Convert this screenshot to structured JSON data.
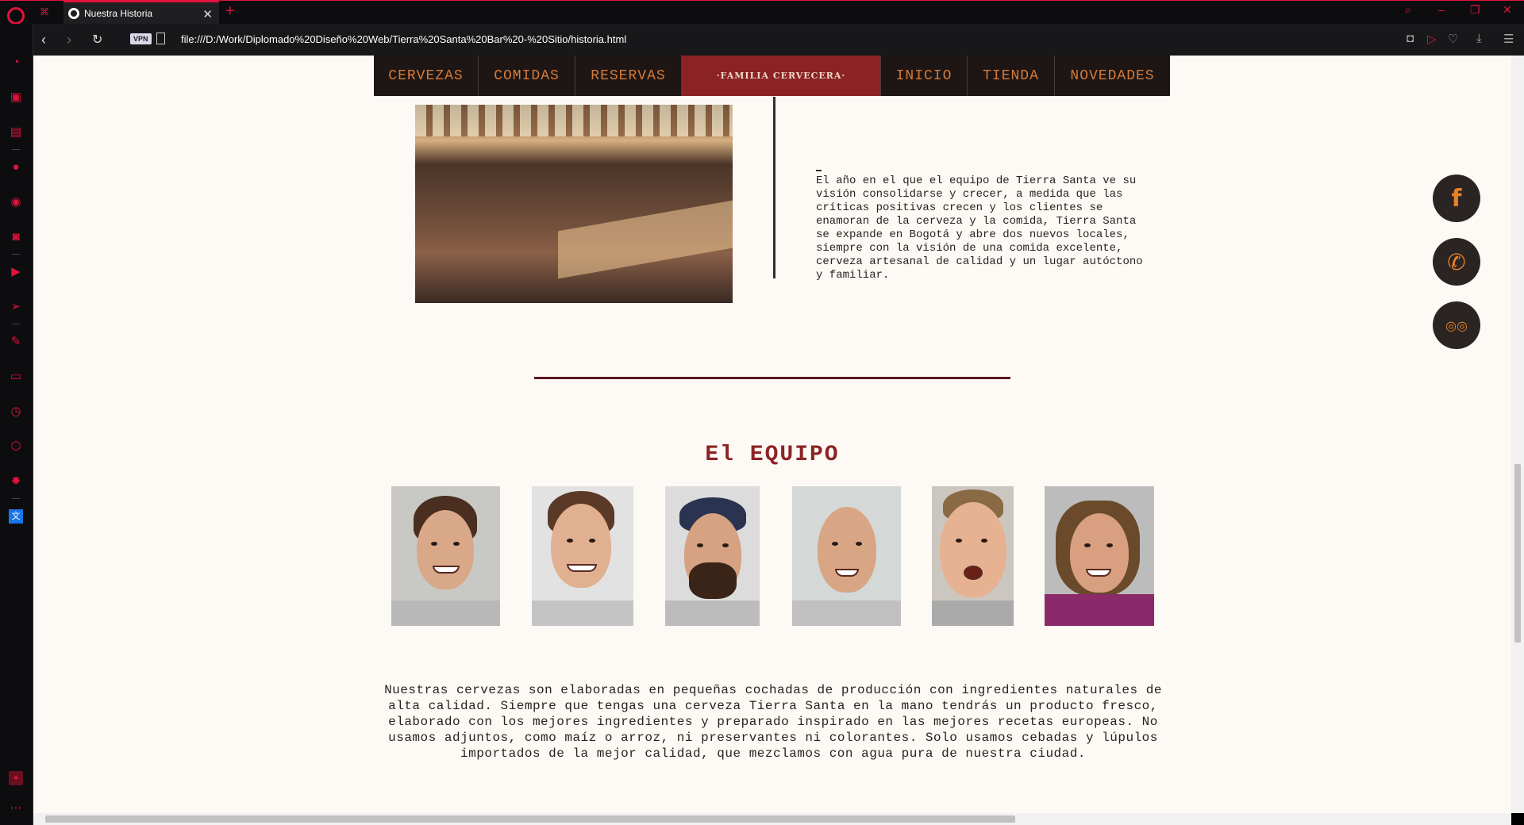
{
  "browser": {
    "tab_title": "Nuestra Historia",
    "tab_close": "✕",
    "new_tab": "+",
    "url": "file:///D:/Work/Diplomado%20Diseño%20Web/Tierra%20Santa%20Bar%20-%20Sitio/historia.html",
    "vpn_label": "VPN",
    "back": "‹",
    "forward": "›",
    "reload": "↻",
    "minimize": "–",
    "restore": "❐",
    "close": "✕",
    "search_glyph": "⌕"
  },
  "site_nav": {
    "items_left": [
      "CERVEZAS",
      "COMIDAS",
      "RESERVAS"
    ],
    "brand": "·FAMILIA CERVECERA·",
    "items_right": [
      "INICIO",
      "TIENDA",
      "NOVEDADES"
    ]
  },
  "story": {
    "dash": "_",
    "text": "El año en el que el equipo de Tierra Santa ve su visión consolidarse y crecer, a medida que las críticas positivas crecen y los clientes se enamoran de la cerveza y la comida, Tierra Santa se expande en Bogotá y abre dos nuevos locales, siempre con la visión de una comida excelente, cerveza artesanal de calidad y un lugar autóctono y familiar."
  },
  "team": {
    "title": "El EQUIPO",
    "paragraph": "Nuestras cervezas son elaboradas en pequeñas cochadas de producción con ingredientes naturales de alta calidad. Siempre que tengas una cerveza Tierra Santa en la mano tendrás un producto fresco, elaborado con los mejores ingredientes y preparado inspirado en las mejores recetas europeas. No usamos adjuntos, como maíz o arroz, ni preservantes ni colorantes. Solo usamos cebadas y lúpulos importados de la mejor calidad, que mezclamos con agua pura de nuestra ciudad."
  },
  "social": {
    "facebook": "f",
    "phone": "✆",
    "tripadvisor": "◎◎"
  },
  "colors": {
    "accent": "#e0133c",
    "nav_bg": "#1e1614",
    "nav_text": "#d57a38",
    "brand_bg": "#8b2325",
    "page_bg": "#fdf9f5",
    "social_icon": "#e8802a"
  }
}
